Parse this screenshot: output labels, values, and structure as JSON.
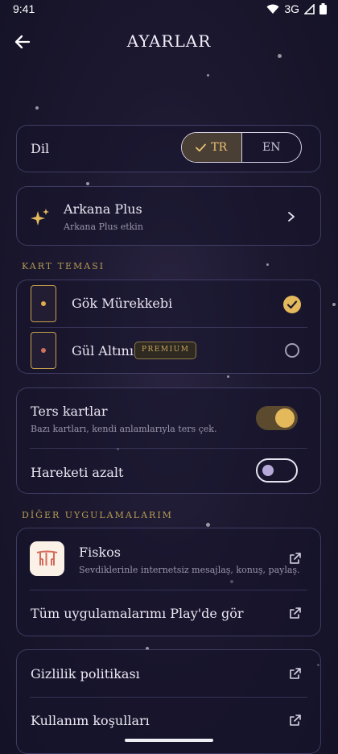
{
  "status": {
    "time": "9:41",
    "network": "3G"
  },
  "header": {
    "title": "AYARLAR"
  },
  "language": {
    "label": "Dil",
    "options": [
      "TR",
      "EN"
    ],
    "selected": "TR"
  },
  "plus": {
    "title": "Arkana Plus",
    "subtitle": "Arkana Plus etkin"
  },
  "card_theme": {
    "section_title": "KART TEMASI",
    "items": [
      {
        "label": "Gök Mürekkebi",
        "selected": true,
        "dot_color": "#e0ad4c"
      },
      {
        "label": "Gül Altını",
        "badge": "PREMIUM",
        "selected": false,
        "dot_color": "#d2705e"
      }
    ]
  },
  "reversed": {
    "label": "Ters kartlar",
    "description": "Bazı kartları, kendi anlamlarıyla ters çek.",
    "enabled": true
  },
  "reduce_motion": {
    "label": "Hareketi azalt",
    "enabled": false
  },
  "other_apps": {
    "section_title": "DİĞER UYGULAMALARIM",
    "app": {
      "name": "Fiskos",
      "description": "Sevdiklerinle internetsiz mesajlaş, konuş, paylaş."
    },
    "see_all": "Tüm uygulamalarımı Play'de gör"
  },
  "links": {
    "privacy": "Gizlilik politikası",
    "terms": "Kullanım koşulları"
  },
  "colors": {
    "accent": "#e4b95c",
    "card_border": "#827dbe",
    "background": "#1c1830"
  }
}
